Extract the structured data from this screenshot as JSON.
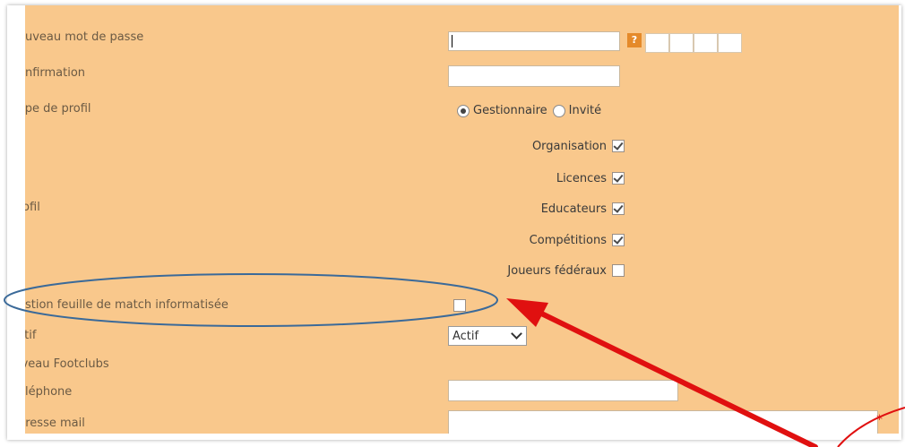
{
  "fields": {
    "new_password_label": "ouveau mot de passe",
    "confirmation_label": "onfirmation",
    "profile_type_label": "ype de profil",
    "profile_label": "rofil",
    "match_sheet_label": "estion feuille de match informatisée",
    "active_label": "ctif",
    "footclubs_level_label": "iveau Footclubs",
    "phone_label": "éléphone",
    "email_label": "dresse mail"
  },
  "profile_type": {
    "options": [
      "Gestionnaire",
      "Invité"
    ],
    "selected": "Gestionnaire"
  },
  "profile_rights": [
    {
      "label": "Organisation",
      "checked": true
    },
    {
      "label": "Licences",
      "checked": true
    },
    {
      "label": "Educateurs",
      "checked": true
    },
    {
      "label": "Compétitions",
      "checked": true
    },
    {
      "label": "Joueurs fédéraux",
      "checked": false
    }
  ],
  "match_sheet": {
    "checked": false
  },
  "status_select": {
    "value": "Actif"
  },
  "help_icon": "question-mark-icon",
  "required_marker": "*",
  "colors": {
    "panel_bg": "#f9c88c",
    "highlight_ellipse": "#3b6a99",
    "arrow": "#e01010"
  }
}
